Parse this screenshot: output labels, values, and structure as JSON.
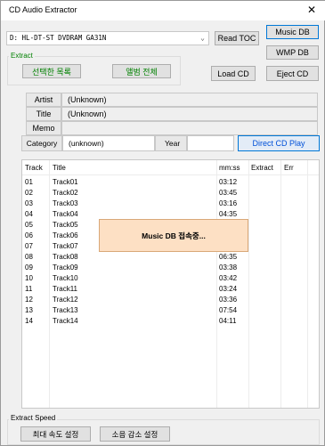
{
  "window": {
    "title": "CD Audio Extractor"
  },
  "drive": {
    "selected": "D:  HL-DT-ST DVDRAM GA31N"
  },
  "buttons": {
    "read_toc": "Read TOC",
    "music_db": "Music DB",
    "wmp_db": "WMP DB",
    "load_cd": "Load CD",
    "eject_cd": "Eject CD",
    "direct_cd_play": "Direct CD Play"
  },
  "extract": {
    "label": "Extract",
    "selected_list": "선택한 목록",
    "whole_album": "앨범 전체"
  },
  "info": {
    "artist_label": "Artist",
    "artist_value": "(Unknown)",
    "title_label": "Title",
    "title_value": "(Unknown)",
    "memo_label": "Memo",
    "memo_value": "",
    "category_label": "Category",
    "category_value": "(unknown)",
    "year_label": "Year",
    "year_value": ""
  },
  "table": {
    "headers": [
      "Track",
      "Title",
      "mm:ss",
      "Extract",
      "Err"
    ],
    "rows": [
      {
        "track": "01",
        "title": "Track01",
        "time": "03:12"
      },
      {
        "track": "02",
        "title": "Track02",
        "time": "03:45"
      },
      {
        "track": "03",
        "title": "Track03",
        "time": "03:16"
      },
      {
        "track": "04",
        "title": "Track04",
        "time": "04:35"
      },
      {
        "track": "05",
        "title": "Track05",
        "time": ""
      },
      {
        "track": "06",
        "title": "Track06",
        "time": ""
      },
      {
        "track": "07",
        "title": "Track07",
        "time": "04:40"
      },
      {
        "track": "08",
        "title": "Track08",
        "time": "06:35"
      },
      {
        "track": "09",
        "title": "Track09",
        "time": "03:38"
      },
      {
        "track": "10",
        "title": "Track10",
        "time": "03:42"
      },
      {
        "track": "11",
        "title": "Track11",
        "time": "03:24"
      },
      {
        "track": "12",
        "title": "Track12",
        "time": "03:36"
      },
      {
        "track": "13",
        "title": "Track13",
        "time": "07:54"
      },
      {
        "track": "14",
        "title": "Track14",
        "time": "04:11"
      }
    ]
  },
  "popup": {
    "text": "Music DB 접속중..."
  },
  "speed": {
    "label": "Extract Speed",
    "max_speed": "최대 속도 설정",
    "noise_reduction": "소음 감소 설정"
  },
  "colors": {
    "accent_blue": "#0078d7",
    "green_text": "#008000",
    "popup_bg": "#fde0c4"
  }
}
